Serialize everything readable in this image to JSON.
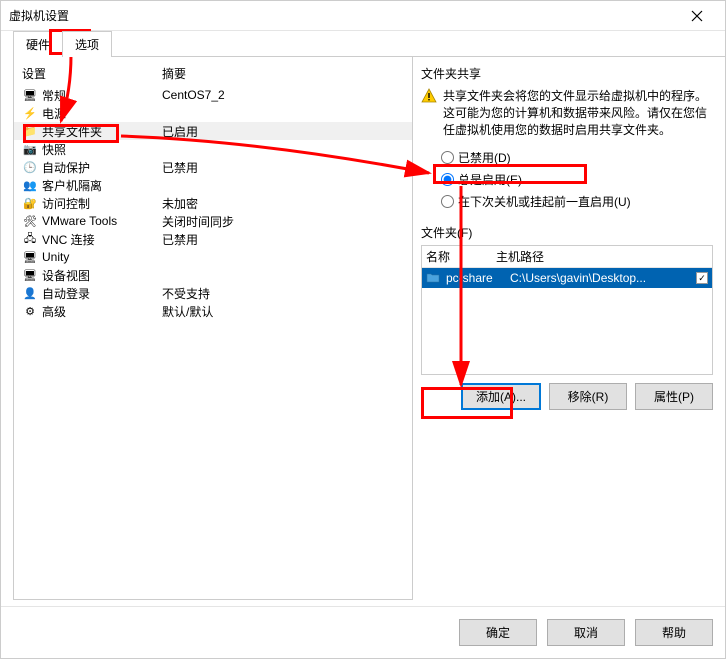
{
  "window": {
    "title": "虚拟机设置"
  },
  "tabs": {
    "hardware": "硬件",
    "options": "选项"
  },
  "left": {
    "header_setting": "设置",
    "header_summary": "摘要",
    "items": [
      {
        "icon": "🖥",
        "label": "常规",
        "summary": "CentOS7_2"
      },
      {
        "icon": "⚡",
        "label": "电源",
        "summary": ""
      },
      {
        "icon": "📁",
        "label": "共享文件夹",
        "summary": "已启用"
      },
      {
        "icon": "📷",
        "label": "快照",
        "summary": ""
      },
      {
        "icon": "🕒",
        "label": "自动保护",
        "summary": "已禁用"
      },
      {
        "icon": "👥",
        "label": "客户机隔离",
        "summary": ""
      },
      {
        "icon": "🔐",
        "label": "访问控制",
        "summary": "未加密"
      },
      {
        "icon": "🛠",
        "label": "VMware Tools",
        "summary": "关闭时间同步"
      },
      {
        "icon": "🖧",
        "label": "VNC 连接",
        "summary": "已禁用"
      },
      {
        "icon": "🖥",
        "label": "Unity",
        "summary": ""
      },
      {
        "icon": "🖥",
        "label": "设备视图",
        "summary": ""
      },
      {
        "icon": "👤",
        "label": "自动登录",
        "summary": "不受支持"
      },
      {
        "icon": "⚙",
        "label": "高级",
        "summary": "默认/默认"
      }
    ]
  },
  "right": {
    "share_title": "文件夹共享",
    "warning": "共享文件夹会将您的文件显示给虚拟机中的程序。这可能为您的计算机和数据带来风险。请仅在您信任虚拟机使用您的数据时启用共享文件夹。",
    "radio_disabled": "已禁用(D)",
    "radio_always": "总是启用(E)",
    "radio_until": "在下次关机或挂起前一直启用(U)",
    "folders_title": "文件夹(F)",
    "col_name": "名称",
    "col_host": "主机路径",
    "folders": [
      {
        "name": "pc-share",
        "path": "C:\\Users\\gavin\\Desktop..."
      }
    ],
    "btn_add": "添加(A)...",
    "btn_remove": "移除(R)",
    "btn_props": "属性(P)"
  },
  "footer": {
    "ok": "确定",
    "cancel": "取消",
    "help": "帮助"
  }
}
